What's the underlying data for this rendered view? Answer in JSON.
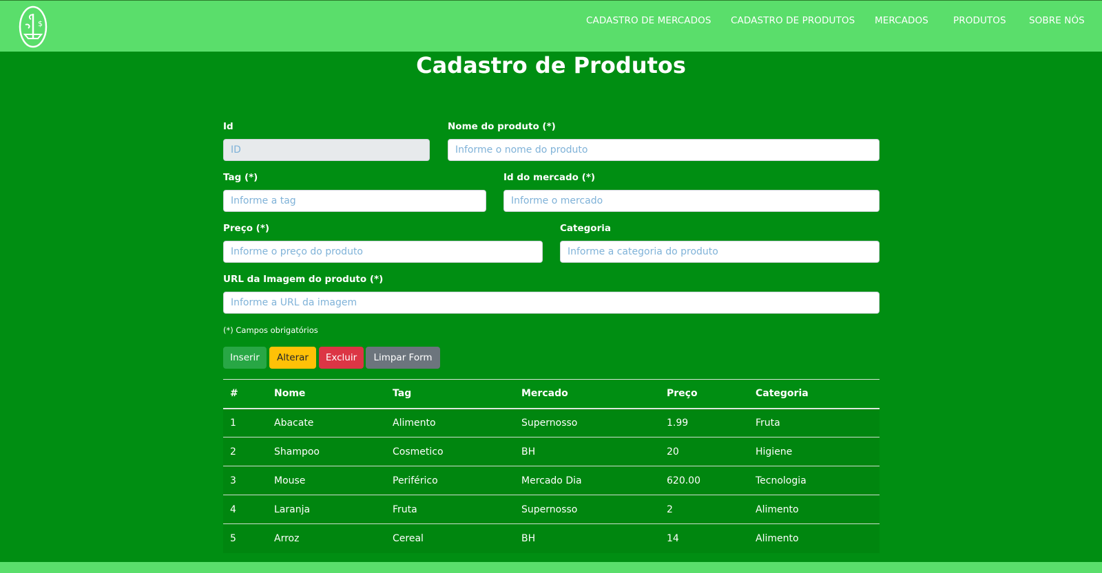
{
  "nav": {
    "items": [
      "CADASTRO DE MERCADOS",
      "CADASTRO DE PRODUTOS",
      "MERCADOS",
      "PRODUTOS",
      "SOBRE NÓS"
    ]
  },
  "page": {
    "title": "Cadastro de Produtos"
  },
  "form": {
    "id": {
      "label": "Id",
      "placeholder": "ID"
    },
    "nome": {
      "label": "Nome do produto (*)",
      "placeholder": "Informe o nome do produto"
    },
    "tag": {
      "label": "Tag (*)",
      "placeholder": "Informe a tag"
    },
    "mercado": {
      "label": "Id do mercado (*)",
      "placeholder": "Informe o mercado"
    },
    "preco": {
      "label": "Preço (*)",
      "placeholder": "Informe o preço do produto"
    },
    "categoria": {
      "label": "Categoria",
      "placeholder": "Informe a categoria do produto"
    },
    "url": {
      "label": "URL da Imagem do produto (*)",
      "placeholder": "Informe a URL da imagem"
    },
    "note": "(*) Campos obrigatórios"
  },
  "buttons": {
    "inserir": "Inserir",
    "alterar": "Alterar",
    "excluir": "Excluir",
    "limpar": "Limpar Form"
  },
  "table": {
    "headers": [
      "#",
      "Nome",
      "Tag",
      "Mercado",
      "Preço",
      "Categoria"
    ],
    "rows": [
      [
        "1",
        "Abacate",
        "Alimento",
        "Supernosso",
        "1.99",
        "Fruta"
      ],
      [
        "2",
        "Shampoo",
        "Cosmetico",
        "BH",
        "20",
        "Higiene"
      ],
      [
        "3",
        "Mouse",
        "Periférico",
        "Mercado Dia",
        "620.00",
        "Tecnologia"
      ],
      [
        "4",
        "Laranja",
        "Fruta",
        "Supernosso",
        "2",
        "Alimento"
      ],
      [
        "5",
        "Arroz",
        "Cereal",
        "BH",
        "14",
        "Alimento"
      ]
    ]
  },
  "colors": {
    "header_bg": "#5ade6b",
    "page_bg": "#008e12"
  }
}
